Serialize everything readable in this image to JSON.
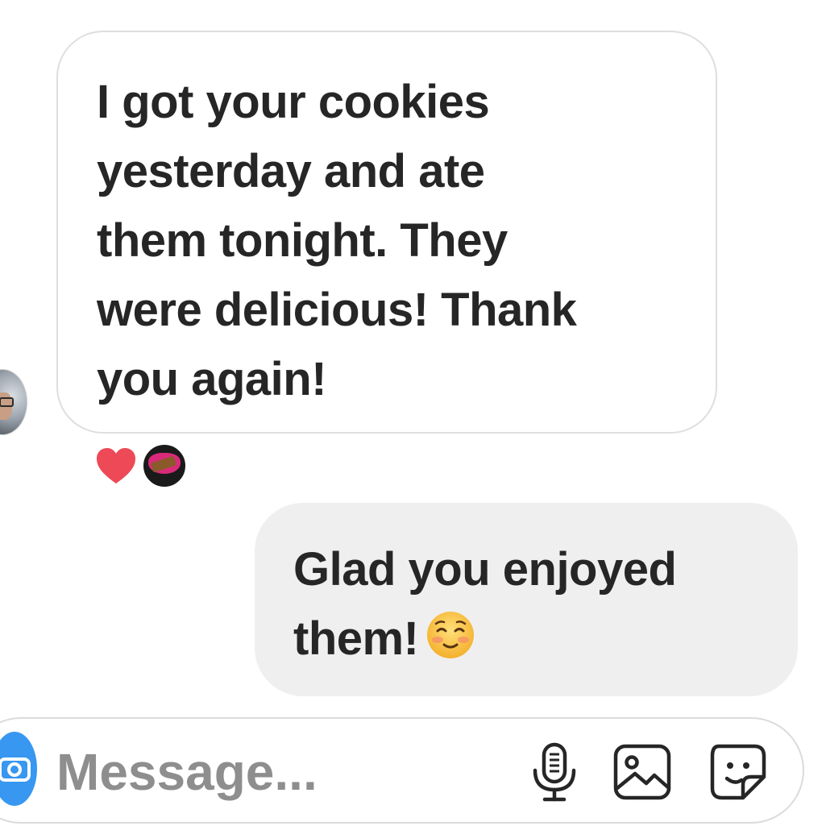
{
  "conversation": {
    "messages": [
      {
        "direction": "received",
        "text": "I got your cookies\nyesterday and ate\nthem tonight. They\nwere delicious! Thank\nyou again!",
        "reactions": [
          "heart-emoji",
          "reactor-avatar"
        ]
      },
      {
        "direction": "sent",
        "text": "Glad you enjoyed\nthem!",
        "emoji": "smiling-face-icon"
      }
    ]
  },
  "composer": {
    "placeholder": "Message...",
    "value": "",
    "icons": [
      "camera-icon",
      "microphone-icon",
      "gallery-icon",
      "sticker-icon"
    ]
  },
  "colors": {
    "accent": "#3897f0",
    "heart": "#ed4956",
    "sent_bubble": "#efefef",
    "received_border": "#dedede",
    "text": "#262626",
    "placeholder": "#8e8e8e"
  }
}
